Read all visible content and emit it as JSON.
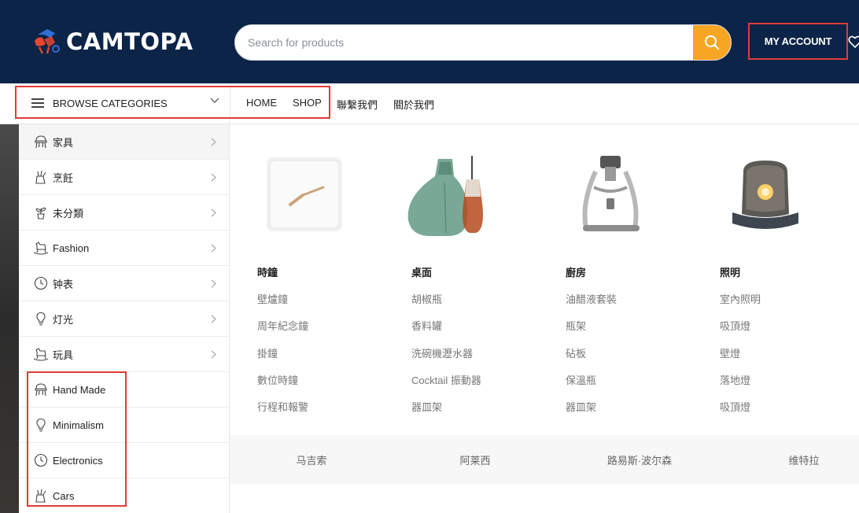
{
  "header": {
    "logo_text": "CAMTOPA",
    "search_placeholder": "Search for products",
    "account_label": "MY ACCOUNT",
    "colors": {
      "bg": "#0b2447",
      "accent": "#f6a623",
      "highlight": "#e23a3a"
    }
  },
  "nav": {
    "browse_label": "BROWSE CATEGORIES",
    "links": [
      "HOME",
      "SHOP",
      "聯繫我們",
      "關於我們"
    ]
  },
  "sidebar": {
    "items": [
      {
        "label": "家具",
        "icon": "chair-icon",
        "chevron": true
      },
      {
        "label": "烹飪",
        "icon": "knife-block-icon",
        "chevron": true
      },
      {
        "label": "未分類",
        "icon": "plant-icon",
        "chevron": true
      },
      {
        "label": "Fashion",
        "icon": "rocking-horse-icon",
        "chevron": true
      },
      {
        "label": "钟表",
        "icon": "clock-icon",
        "chevron": true
      },
      {
        "label": "灯光",
        "icon": "lightbulb-icon",
        "chevron": true
      },
      {
        "label": "玩具",
        "icon": "rocking-horse-icon",
        "chevron": true
      },
      {
        "label": "Hand Made",
        "icon": "chair-icon",
        "chevron": false
      },
      {
        "label": "Minimalism",
        "icon": "lightbulb-icon",
        "chevron": false
      },
      {
        "label": "Electronics",
        "icon": "clock-icon",
        "chevron": false
      },
      {
        "label": "Cars",
        "icon": "knife-block-icon",
        "chevron": false
      }
    ]
  },
  "mega": {
    "columns": [
      {
        "title": "時鐘",
        "image": "wall-clock-image",
        "links": [
          "壁爐鐘",
          "周年紀念鐘",
          "掛鐘",
          "數位時鐘",
          "行程和報警"
        ]
      },
      {
        "title": "桌面",
        "image": "carafe-image",
        "links": [
          "胡椒瓶",
          "香料罐",
          "洗碗機瀝水器",
          "Cocktail 振動器",
          "器皿架"
        ]
      },
      {
        "title": "廚房",
        "image": "espresso-press-image",
        "links": [
          "油醋液套裝",
          "瓶架",
          "砧板",
          "保溫瓶",
          "器皿架"
        ]
      },
      {
        "title": "照明",
        "image": "table-lamp-image",
        "links": [
          "室內照明",
          "吸頂燈",
          "壁燈",
          "落地燈",
          "吸頂燈"
        ]
      }
    ],
    "brands": [
      "马吉索",
      "阿莱西",
      "路易斯·波尔森",
      "维特拉"
    ]
  }
}
